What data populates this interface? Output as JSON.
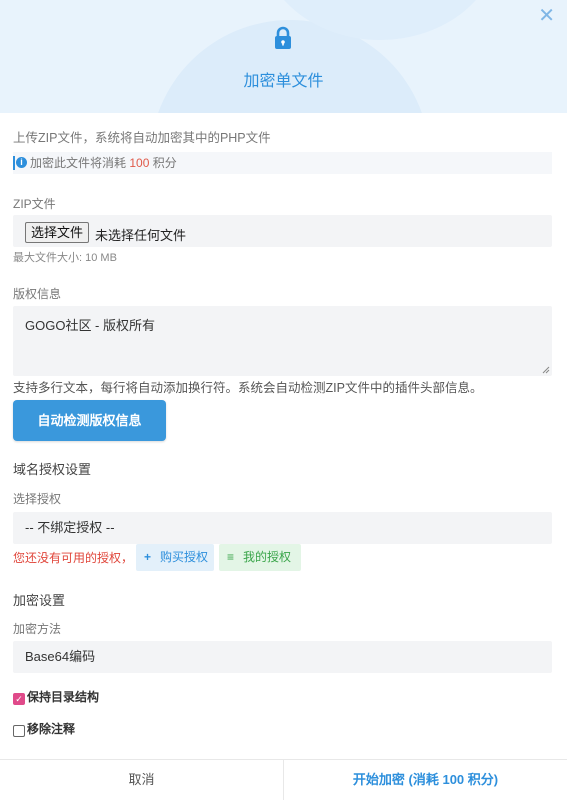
{
  "dialog": {
    "title": "加密单文件",
    "close_glyph": "✕",
    "lock_icon": "lock-icon",
    "accent_color": "#2d8fdc"
  },
  "intro": "上传ZIP文件，系统将自动加密其中的PHP文件",
  "notice": {
    "prefix": "加密此文件将消耗 ",
    "cost": "100",
    "suffix": " 积分",
    "info_glyph": "i"
  },
  "zip": {
    "label": "ZIP文件",
    "button_label": "选择文件",
    "status": "未选择任何文件",
    "max_size": "最大文件大小: 10 MB"
  },
  "copyright": {
    "label": "版权信息",
    "value": "GOGO社区 - 版权所有",
    "help": "支持多行文本，每行将自动添加换行符。系统会自动检测ZIP文件中的插件头部信息。",
    "detect_button": "自动检测版权信息"
  },
  "domain": {
    "section_title": "域名授权设置",
    "select_label": "选择授权",
    "selected": "-- 不绑定授权 --",
    "warning": "您还没有可用的授权，",
    "buy_button": "购买授权",
    "buy_icon": "+",
    "mine_button": "我的授权",
    "mine_icon": "≡"
  },
  "encrypt": {
    "section_title": "加密设置",
    "method_label": "加密方法",
    "method_value": "Base64编码",
    "keep_structure": {
      "label": "保持目录结构",
      "checked": true,
      "glyph": "✓"
    },
    "remove_comments": {
      "label": "移除注释",
      "checked": false
    }
  },
  "footer": {
    "cancel": "取消",
    "start": "开始加密 (消耗 100 积分)"
  }
}
